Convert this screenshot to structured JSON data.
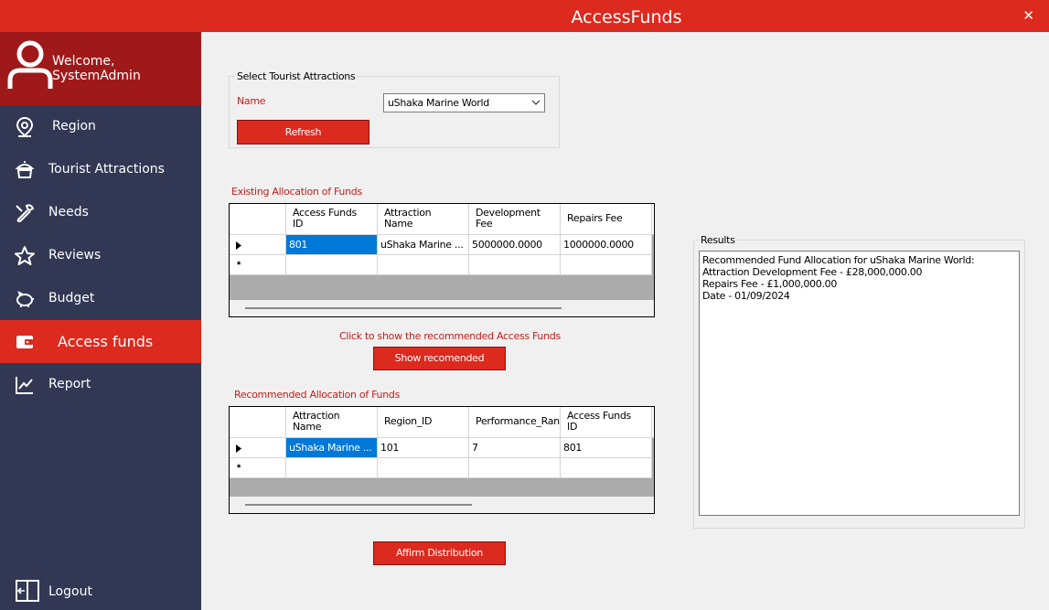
{
  "window": {
    "title": "AccessFunds",
    "close_glyph": "✕"
  },
  "sidebar": {
    "welcome": "Welcome, SystemAdmin",
    "items": [
      {
        "label": "Region",
        "icon": "map-pin-icon"
      },
      {
        "label": "Tourist Attractions",
        "icon": "attraction-icon"
      },
      {
        "label": "Needs",
        "icon": "wrench-icon"
      },
      {
        "label": "Reviews",
        "icon": "star-icon"
      },
      {
        "label": "Budget",
        "icon": "piggy-bank-icon"
      },
      {
        "label": "Access funds",
        "icon": "wallet-icon",
        "active": true
      },
      {
        "label": "Report",
        "icon": "chart-line-icon"
      }
    ],
    "logout": "Logout"
  },
  "select_group": {
    "legend": "Select Tourist Attractions",
    "name_label": "Name",
    "selected": "uShaka Marine World",
    "refresh_label": "Refresh"
  },
  "existing": {
    "label": "Existing Allocation of Funds",
    "columns": [
      "Access Funds\nID",
      "Attraction\nName",
      "Development\nFee",
      "Repairs Fee"
    ],
    "rows": [
      [
        "801",
        "uShaka Marine ...",
        "5000000.0000",
        "1000000.0000"
      ]
    ],
    "new_row_marker": "*"
  },
  "show_prompt": "Click to show the recommended Access Funds",
  "show_button": "Show recomended",
  "recommended": {
    "label": "Recommended Allocation of Funds",
    "columns": [
      "Attraction\nName",
      "Region_ID",
      "Performance_Rank",
      "Access Funds\nID"
    ],
    "rows": [
      [
        "uShaka Marine ...",
        "101",
        "7",
        "801"
      ]
    ],
    "new_row_marker": "*"
  },
  "affirm_button": "Affirm Distribution",
  "results": {
    "legend": "Results",
    "lines": [
      "Recommended Fund Allocation for uShaka Marine World:",
      "Attraction Development Fee - £28,000,000.00",
      "Repairs Fee - £1,000,000.00",
      "Date - 01/09/2024"
    ]
  },
  "colors": {
    "accent": "#dc2a1e",
    "sidebar": "#323854",
    "profile": "#a0191a",
    "selection": "#0078d7"
  }
}
